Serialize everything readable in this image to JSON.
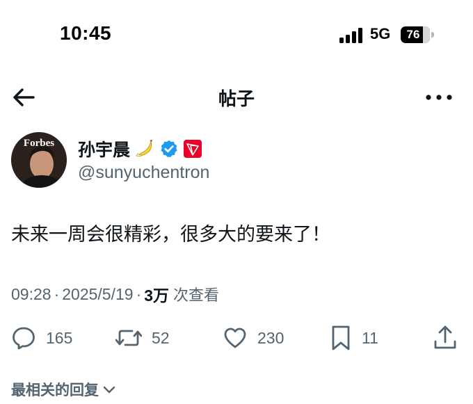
{
  "status_bar": {
    "time": "10:45",
    "network": "5G",
    "battery_level": "76",
    "battery_fraction": 0.76
  },
  "header": {
    "title": "帖子",
    "back_icon": "arrow-left-icon",
    "more_icon": "more-horizontal-icon"
  },
  "author": {
    "display_name": "孙宇晨",
    "handle": "@sunyuchentron",
    "avatar_text": "Forbes",
    "badges": [
      "banana-emoji",
      "verified-icon",
      "tron-badge-icon"
    ],
    "verified_color": "#1d9bf0",
    "tron_color": "#eb0029"
  },
  "post": {
    "text": "未来一周会很精彩，很多大的要来了！",
    "time": "09:28",
    "separator": "·",
    "date": "2025/5/19",
    "views_count": "3万",
    "views_label": "次查看"
  },
  "actions": {
    "replies": "165",
    "reposts": "52",
    "likes": "230",
    "bookmarks": "11"
  },
  "replies_sort": {
    "label": "最相关的回复"
  },
  "colors": {
    "text_primary": "#0f1419",
    "text_secondary": "#536471",
    "accent": "#1d9bf0"
  }
}
